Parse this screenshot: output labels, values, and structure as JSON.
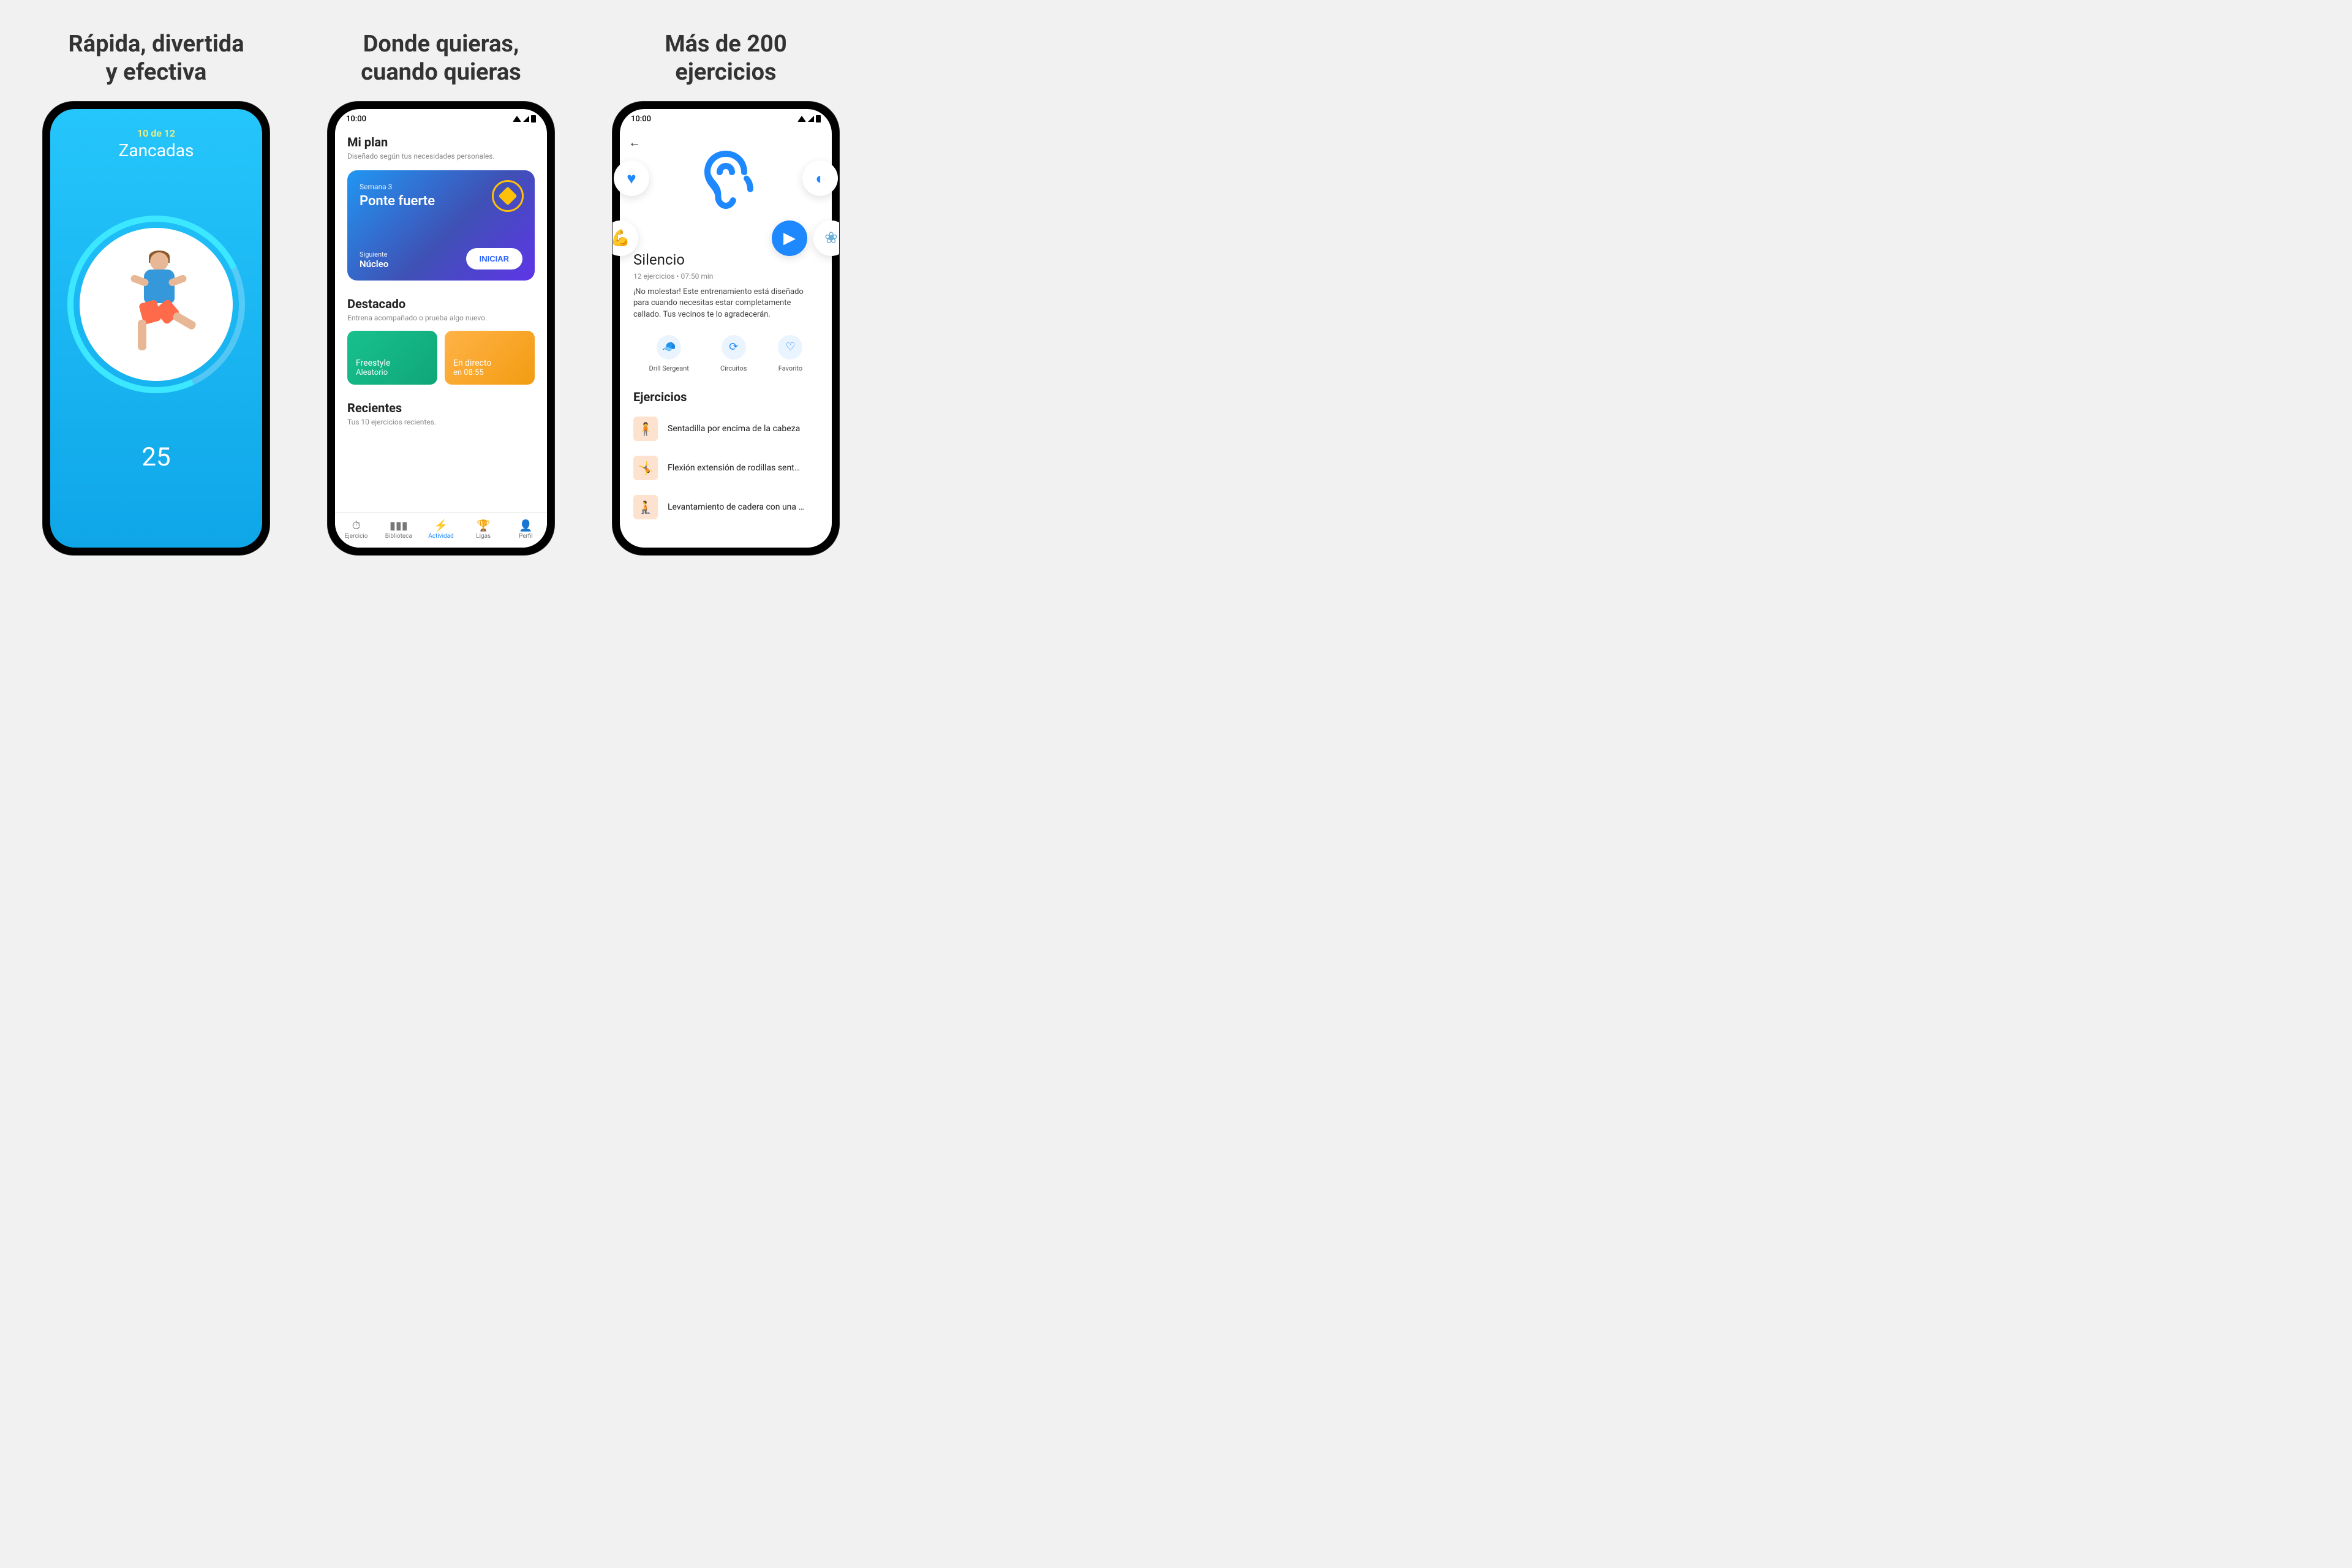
{
  "cols": {
    "one": {
      "headline": "Rápida, divertida\ny efectiva"
    },
    "two": {
      "headline": "Donde quieras,\ncuando quieras"
    },
    "three": {
      "headline": "Más de 200\nejercicios"
    }
  },
  "status": {
    "time": "10:00"
  },
  "screen1": {
    "counter": "10 de 12",
    "exercise": "Zancadas",
    "seconds": "25"
  },
  "screen2": {
    "plan_heading": "Mi plan",
    "plan_sub": "Diseñado según tus necesidades personales.",
    "card": {
      "week": "Semana 3",
      "title": "Ponte fuerte",
      "next_label": "Siguiente",
      "next_value": "Núcleo",
      "start": "INICIAR"
    },
    "featured_heading": "Destacado",
    "featured_sub": "Entrena acompañado o prueba algo nuevo.",
    "cards": {
      "a_title": "Freestyle",
      "a_sub": "Aleatorio",
      "b_title": "En directo",
      "b_sub": "en 08:55"
    },
    "recent_heading": "Recientes",
    "recent_sub": "Tus 10 ejercicios recientes.",
    "nav": {
      "exercise": "Ejercicio",
      "library": "Biblioteca",
      "activity": "Actividad",
      "leagues": "Ligas",
      "profile": "Perfil"
    }
  },
  "screen3": {
    "title": "Silencio",
    "meta": "12 ejercicios • 07:50 min",
    "desc": "¡No molestar! Este entrenamiento está diseñado para cuando necesitas estar completamente callado. Tus vecinos te lo agradecerán.",
    "actions": {
      "drill": "Drill Sergeant",
      "circuits": "Circuitos",
      "favorite": "Favorito"
    },
    "section": "Ejercicios",
    "items": [
      "Sentadilla por encima de la cabeza",
      "Flexión extensión de rodillas sent…",
      "Levantamiento de cadera con una …"
    ]
  }
}
